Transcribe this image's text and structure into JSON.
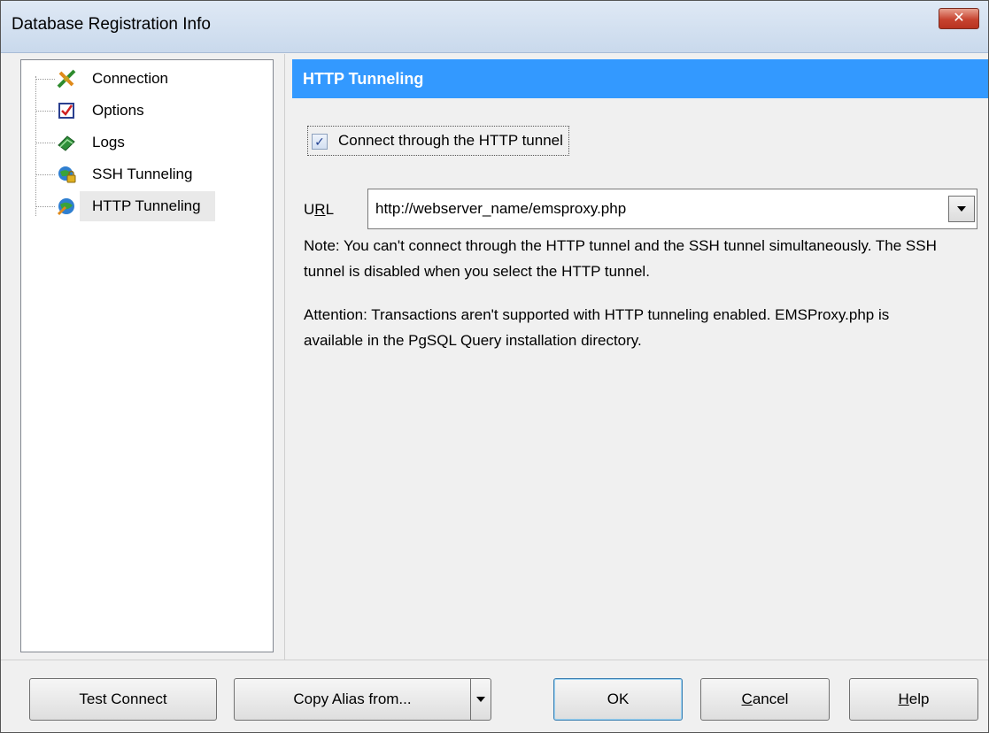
{
  "window": {
    "title": "Database Registration Info",
    "close_symbol": "✕"
  },
  "tree": {
    "items": [
      {
        "label": "Connection",
        "icon": "connection-plug-icon"
      },
      {
        "label": "Options",
        "icon": "checklist-icon"
      },
      {
        "label": "Logs",
        "icon": "log-book-icon"
      },
      {
        "label": "SSH Tunneling",
        "icon": "ssh-globe-lock-icon"
      },
      {
        "label": "HTTP Tunneling",
        "icon": "http-globe-icon",
        "selected": true
      }
    ]
  },
  "panel": {
    "header": "HTTP Tunneling",
    "checkbox_label": "Connect through the HTTP tunnel",
    "checkbox_checked": true,
    "checkbox_mark": "✓",
    "url_label_first": "U",
    "url_label_underlined": "R",
    "url_label_rest": "L",
    "url_value": "http://webserver_name/emsproxy.php",
    "note": "Note: You can't connect through the HTTP tunnel and the SSH tunnel simultaneously. The SSH tunnel is disabled  when you select the HTTP tunnel.",
    "attention": "Attention: Transactions aren't supported with HTTP tunneling enabled. EMSProxy.php is available in the PgSQL Query installation directory."
  },
  "buttons": {
    "test_connect": "Test Connect",
    "copy_alias": "Copy Alias from...",
    "ok": "OK",
    "cancel_underlined": "C",
    "cancel_rest": "ancel",
    "help_underlined": "H",
    "help_rest": "elp"
  },
  "colors": {
    "header_bg": "#3399ff",
    "close_button": "#c7432f"
  }
}
